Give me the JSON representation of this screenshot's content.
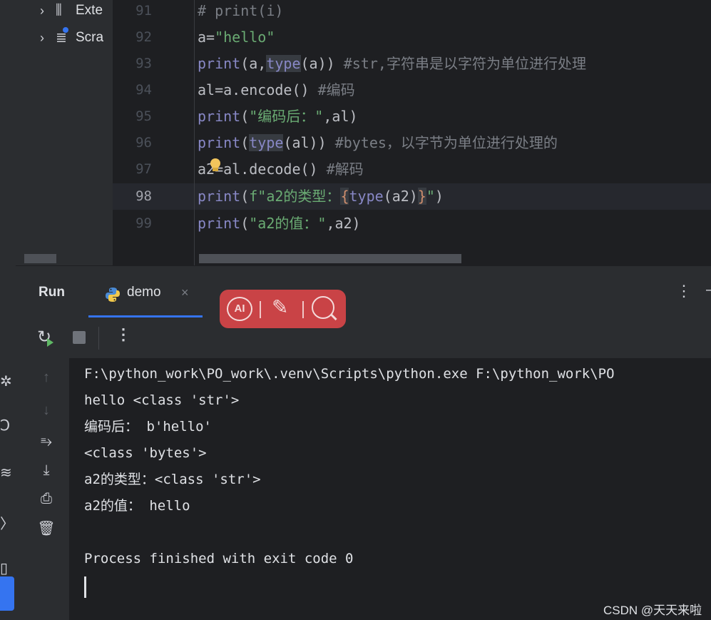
{
  "project_tree": {
    "items": [
      {
        "label": "Exte",
        "icon": "external-libraries-icon"
      },
      {
        "label": "Scra",
        "icon": "scratches-icon"
      }
    ]
  },
  "editor": {
    "lines": [
      {
        "no": "91",
        "text": "# print(i)"
      },
      {
        "no": "92",
        "text": "a=\"hello\""
      },
      {
        "no": "93",
        "text": "print(a,type(a)) #str,字符串是以字符为单位进行处理"
      },
      {
        "no": "94",
        "text": "al=a.encode() #编码"
      },
      {
        "no": "95",
        "text": "print(\"编码后：\",al)"
      },
      {
        "no": "96",
        "text": "print(type(al)) #bytes，以字节为单位进行处理的"
      },
      {
        "no": "97",
        "text": "a2=al.decode() #解码"
      },
      {
        "no": "98",
        "text": "print(f\"a2的类型：{type(a2)}\")"
      },
      {
        "no": "99",
        "text": "print(\"a2的值：\",a2)"
      }
    ],
    "current_line": "98",
    "segments": {
      "l91": "# print(i)",
      "l92_a": "a=",
      "l92_b": "\"hello\"",
      "l93_a": "print",
      "l93_b": "(a,",
      "l93_c": "type",
      "l93_d": "(a)) ",
      "l93_e": "#str,字符串是以字符为单位进行处理",
      "l94_a": "al=a.encode() ",
      "l94_b": "#编码",
      "l95_a": "print",
      "l95_b": "(",
      "l95_c": "\"编码后：\"",
      "l95_d": ",al)",
      "l96_a": "print",
      "l96_b": "(",
      "l96_c": "type",
      "l96_d": "(al)) ",
      "l96_e": "#bytes，以字节为单位进行处理的",
      "l97_a": "a2=al.decode() ",
      "l97_b": "#解码",
      "l98_a": "print",
      "l98_b": "(",
      "l98_c": "f\"a2的类型：",
      "l98_d": "{",
      "l98_e": "type",
      "l98_f": "(a2)",
      "l98_g": "}",
      "l98_h": "\"",
      "l98_i": ")",
      "l99_a": "print",
      "l99_b": "(",
      "l99_c": "\"a2的值：\"",
      "l99_d": ",a2)"
    }
  },
  "run_window": {
    "title": "Run",
    "tab_label": "demo",
    "tab_close": "×",
    "more": "⋮",
    "ai_label": "AI",
    "toolbar_more": "⋮"
  },
  "console": {
    "lines": [
      "F:\\python_work\\PO_work\\.venv\\Scripts\\python.exe F:\\python_work\\PO",
      "hello <class 'str'>",
      "编码后： b'hello'",
      "<class 'bytes'>",
      "a2的类型：<class 'str'>",
      "a2的值： hello",
      "",
      "Process finished with exit code 0"
    ]
  },
  "watermark": "CSDN @天天来啦",
  "colors": {
    "background": "#1e1f22",
    "panel": "#2b2d30",
    "accent": "#3574f0",
    "string": "#6aab73",
    "keyword": "#8888c6",
    "comment": "#7a7e85",
    "ai_popup": "#c94346"
  }
}
